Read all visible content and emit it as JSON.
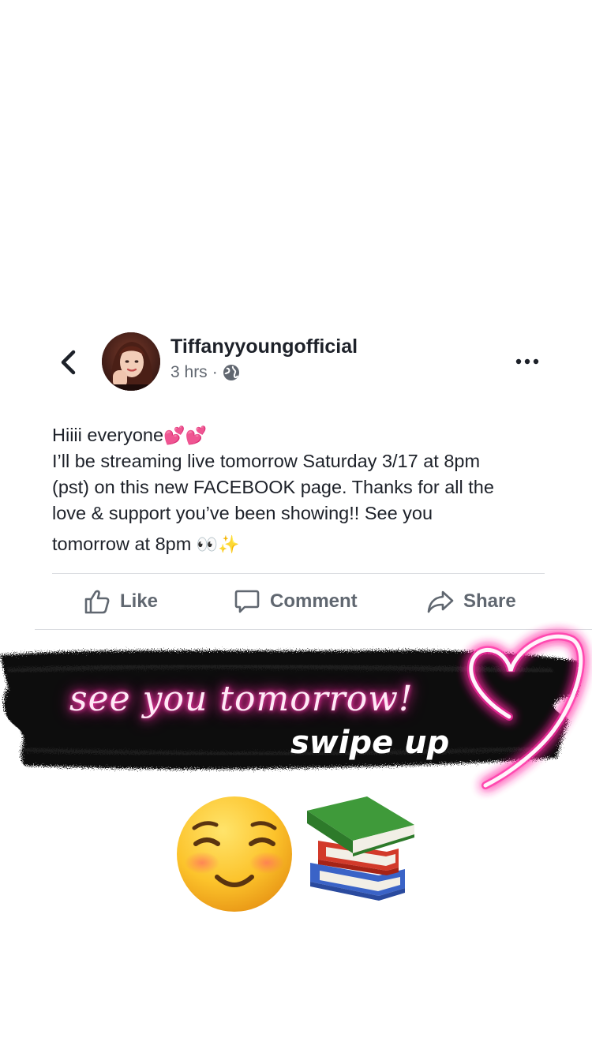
{
  "post": {
    "author": "Tiffanyyoungofficial",
    "time": "3 hrs",
    "separator": "·",
    "privacy_icon": "globe-icon",
    "lines": [
      "Hiiii everyone",
      "I’ll be streaming live tomorrow Saturday 3/17 at 8pm",
      "(pst) on this new FACEBOOK page. Thanks for all the",
      "love & support you’ve been showing!! See you",
      "tomorrow at 8pm"
    ],
    "emoji_after_line1": "💕💕",
    "emoji_after_last_line": "👀✨"
  },
  "actions": {
    "like": "Like",
    "comment": "Comment",
    "share": "Share"
  },
  "sticker": {
    "script_text": "see you tomorrow!",
    "swipe_text": "swipe up",
    "emojis": [
      "smiling-face-icon",
      "books-icon"
    ]
  },
  "colors": {
    "facebook_gray": "#606770",
    "text_dark": "#1d2129",
    "neon_pink": "#ff2aa3"
  }
}
